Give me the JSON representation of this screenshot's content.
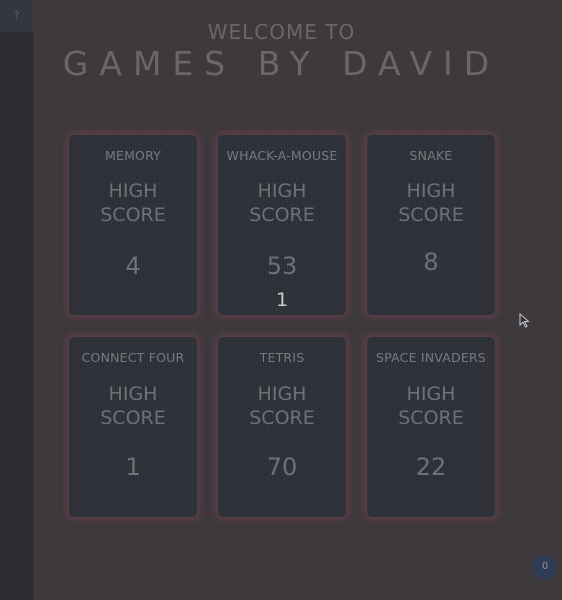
{
  "sidebar": {
    "toggle_label": "?"
  },
  "header": {
    "welcome": "WELCOME TO",
    "brand": "GAMES BY DAVID"
  },
  "games": [
    {
      "title": "MEMORY",
      "high_score_label": "HIGH\nSCORE",
      "score": "4",
      "extra": ""
    },
    {
      "title": "WHACK-A-MOUSE",
      "high_score_label": "HIGH\nSCORE",
      "score": "53",
      "extra": "1"
    },
    {
      "title": "SNAKE",
      "high_score_label": "HIGH\nSCORE",
      "score": "8",
      "extra": ""
    },
    {
      "title": "CONNECT FOUR",
      "high_score_label": "HIGH\nSCORE",
      "score": "1",
      "extra": ""
    },
    {
      "title": "TETRIS",
      "high_score_label": "HIGH\nSCORE",
      "score": "70",
      "extra": ""
    },
    {
      "title": "SPACE INVADERS",
      "high_score_label": "HIGH\nSCORE",
      "score": "22",
      "extra": ""
    }
  ],
  "badge": {
    "count": "0"
  },
  "colors": {
    "background": "#3e393c",
    "card": "#2e3038",
    "card_glow": "#784655",
    "sidebar": "#2b2d33"
  }
}
